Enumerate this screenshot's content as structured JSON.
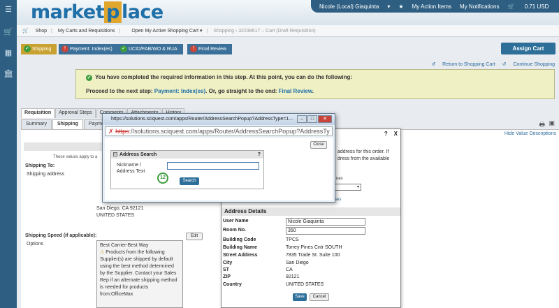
{
  "rail": {
    "icons": [
      "menu-icon",
      "cart-icon",
      "documents-icon",
      "building-icon"
    ]
  },
  "header": {
    "logo_part1": "market",
    "logo_part2": "p",
    "logo_part3": "lace",
    "user": "Nicole (Local) Giaquinta",
    "action_items": "My Action Items",
    "notifications": "My Notifications",
    "cart_total": "0.71 USD"
  },
  "nav": {
    "shop": "Shop",
    "carts": "My Carts and Requisitions",
    "open_cart": "Open My Active Shopping Cart",
    "crumb": "Shopping › 32238617 – Cart (Draft Requisition)"
  },
  "steps": [
    "Shipping",
    "Payment: Index(es)",
    "UCID/FAB/WO & RUA",
    "Final Review"
  ],
  "assign_cart": "Assign Cart",
  "links": {
    "return": "Return to Shopping Cart",
    "continue": "Continue Shopping"
  },
  "notice": {
    "line1": "You have completed the required information in this step. At this point, you can do the following:",
    "line2_a": "Proceed to the next step: ",
    "line2_link1": "Payment: Index(es)",
    "line2_b": ". Or, go straight to the end: ",
    "line2_link2": "Final Review",
    "line2_c": "."
  },
  "tabs1": [
    "Requisition",
    "Approval Steps",
    "Comments",
    "Attachments",
    "History"
  ],
  "tabs2": [
    "Summary",
    "Shipping",
    "Payment"
  ],
  "hide_values": "Hide Value Descriptions",
  "page": {
    "values_apply": "These values apply to a",
    "shipping_to": "Shipping To:",
    "shipping_address": "Shipping address",
    "addr_city": "San Diego, CA 92121",
    "addr_country": "UNITED STATES",
    "shipping_speed": "Shipping Speed (if applicable):",
    "options": "Options",
    "edit": "Edit",
    "speed_title": "Best Carrier-Best Way",
    "speed_text": "Products from the following Supplier(s) are shipped by default using the best method determined by the Supplier. Contact your Sales Rep if an alternate shipping method is needed for products from:OfficeMax"
  },
  "address_dialog": {
    "q": "?",
    "x": "X",
    "intro": "address for this order. If dress from the available",
    "values": "ues",
    "es": "ses",
    "details_header": "Address Details",
    "fields": [
      {
        "label": "User Name",
        "value": "Nicole Giaquinta",
        "input": true
      },
      {
        "label": "Room No.",
        "value": "350",
        "input": true
      },
      {
        "label": "Building Code",
        "value": "TPCS",
        "input": false
      },
      {
        "label": "Building Name",
        "value": "Torrey Pines Cntr SOUTH",
        "input": false
      },
      {
        "label": "Street Address",
        "value": "7835 Trade St. Suite 100",
        "input": false
      },
      {
        "label": "City",
        "value": "San Diego",
        "input": false
      },
      {
        "label": "ST",
        "value": "CA",
        "input": false
      },
      {
        "label": "ZIP",
        "value": "92121",
        "input": false
      },
      {
        "label": "Country",
        "value": "UNITED STATES",
        "input": false
      }
    ],
    "save": "Save",
    "cancel": "Cancel"
  },
  "popup": {
    "title": "https://solutions.sciquest.com/apps/Router/AddressSearchPopup?AddressType=1...",
    "url_prefix": "https",
    "url_rest": "://solutions.sciquest.com/apps/Router/AddressSearchPopup?AddressTy",
    "close": "Close",
    "search_header": "Address Search",
    "help": "?",
    "nickname_label": "Nickname /",
    "address_text_label": "Address Text",
    "input_value": "",
    "step_badge": "12",
    "search": "Search"
  }
}
